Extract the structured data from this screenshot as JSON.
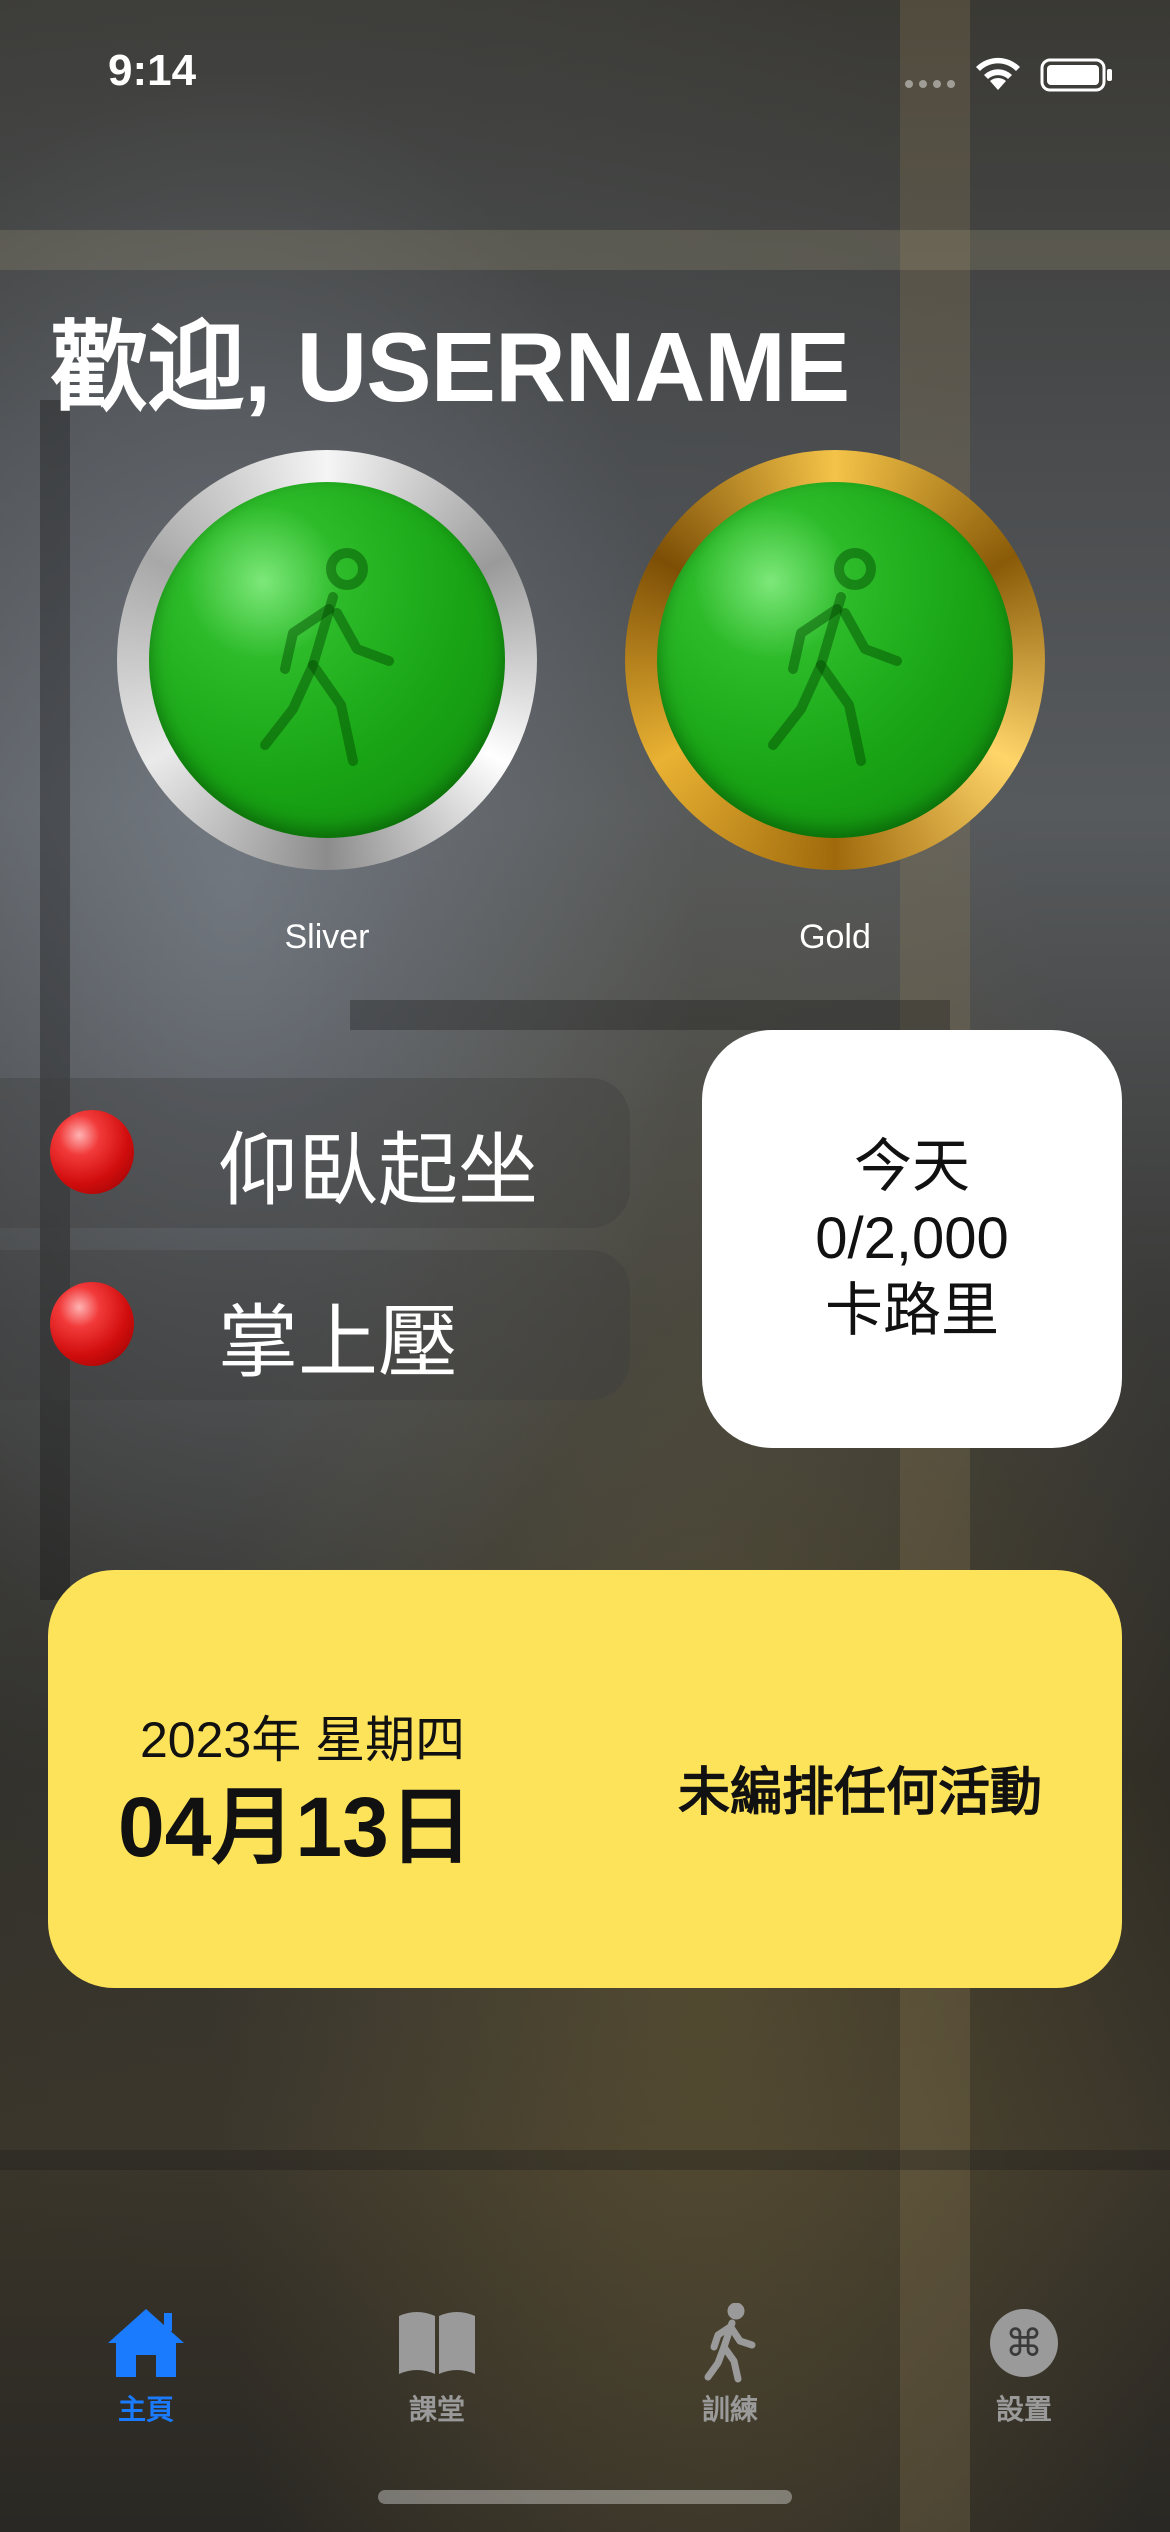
{
  "status_bar": {
    "time": "9:14"
  },
  "header": {
    "welcome": "歡迎, USERNAME"
  },
  "medals": [
    {
      "label": "Sliver",
      "icon": "walking-figure-icon"
    },
    {
      "label": "Gold",
      "icon": "walking-figure-icon"
    }
  ],
  "exercises": [
    {
      "label": "仰臥起坐",
      "status": "red"
    },
    {
      "label": "掌上壓",
      "status": "red"
    }
  ],
  "calories": {
    "line1": "今天",
    "line2": "0/2,000",
    "line3": "卡路里"
  },
  "date_card": {
    "year_weekday": "2023年 星期四",
    "date": "04月13日",
    "schedule": "未編排任何活動"
  },
  "tabs": [
    {
      "label": "主頁",
      "icon": "house-icon",
      "active": true
    },
    {
      "label": "課堂",
      "icon": "book-icon",
      "active": false
    },
    {
      "label": "訓練",
      "icon": "walking-icon",
      "active": false
    },
    {
      "label": "設置",
      "icon": "command-icon",
      "active": false
    }
  ],
  "colors": {
    "accent": "#1a7bff",
    "date_card": "#fde35a",
    "medal_green": "#19a515"
  }
}
